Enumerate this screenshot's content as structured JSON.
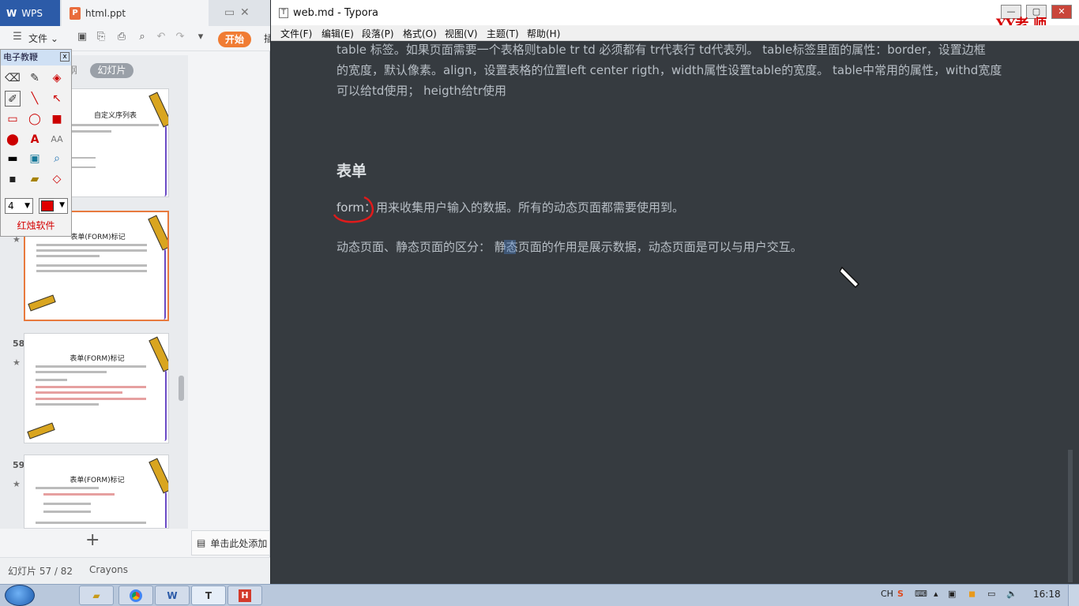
{
  "wps": {
    "app_tab": "WPS",
    "doc_tab": "html.ppt",
    "menu_file": "文件",
    "start_button": "开始",
    "cut_label": "插",
    "panel_tab_outline": "纲",
    "panel_tab_slides": "幻灯片",
    "slides": [
      {
        "num": "",
        "title": "自定义序列表"
      },
      {
        "num": "",
        "title": "表单(FORM)标记"
      },
      {
        "num": "58",
        "title": "表单(FORM)标记"
      },
      {
        "num": "59",
        "title": "表单(FORM)标记"
      }
    ],
    "notes_prompt": "单击此处添加",
    "status_slide": "幻灯片 57 / 82",
    "status_theme": "Crayons"
  },
  "palette": {
    "title": "电子教鞭",
    "pen_size": "4",
    "footer": "红烛软件"
  },
  "typora": {
    "window_title": "web.md - Typora",
    "menu": [
      "文件(F)",
      "编辑(E)",
      "段落(P)",
      "格式(O)",
      "视图(V)",
      "主题(T)",
      "帮助(H)"
    ],
    "watermark": "YY老 师",
    "para1_l1": "table 标签。如果页面需要一个表格则table tr td 必须都有  tr代表行  td代表列。  table标签里面的属性：border，设置边框",
    "para1_l2": "的宽度，默认像素。align，设置表格的位置left center rigth，width属性设置table的宽度。  table中常用的属性，withd宽度",
    "para1_l3": "可以给td使用；  heigth给tr使用",
    "heading": "表单",
    "para2_form": "form：",
    "para2_rest": "用来收集用户输入的数据。所有的动态页面都需要使用到。",
    "para3": "动态页面、静态页面的区分：  静态页面的作用是展示数据，动态页面是可以与用户交互。",
    "colors": {
      "editor_bg": "#363b40",
      "accent_red": "#d40000"
    }
  },
  "taskbar": {
    "lang": "CH",
    "clock": "16:18"
  }
}
